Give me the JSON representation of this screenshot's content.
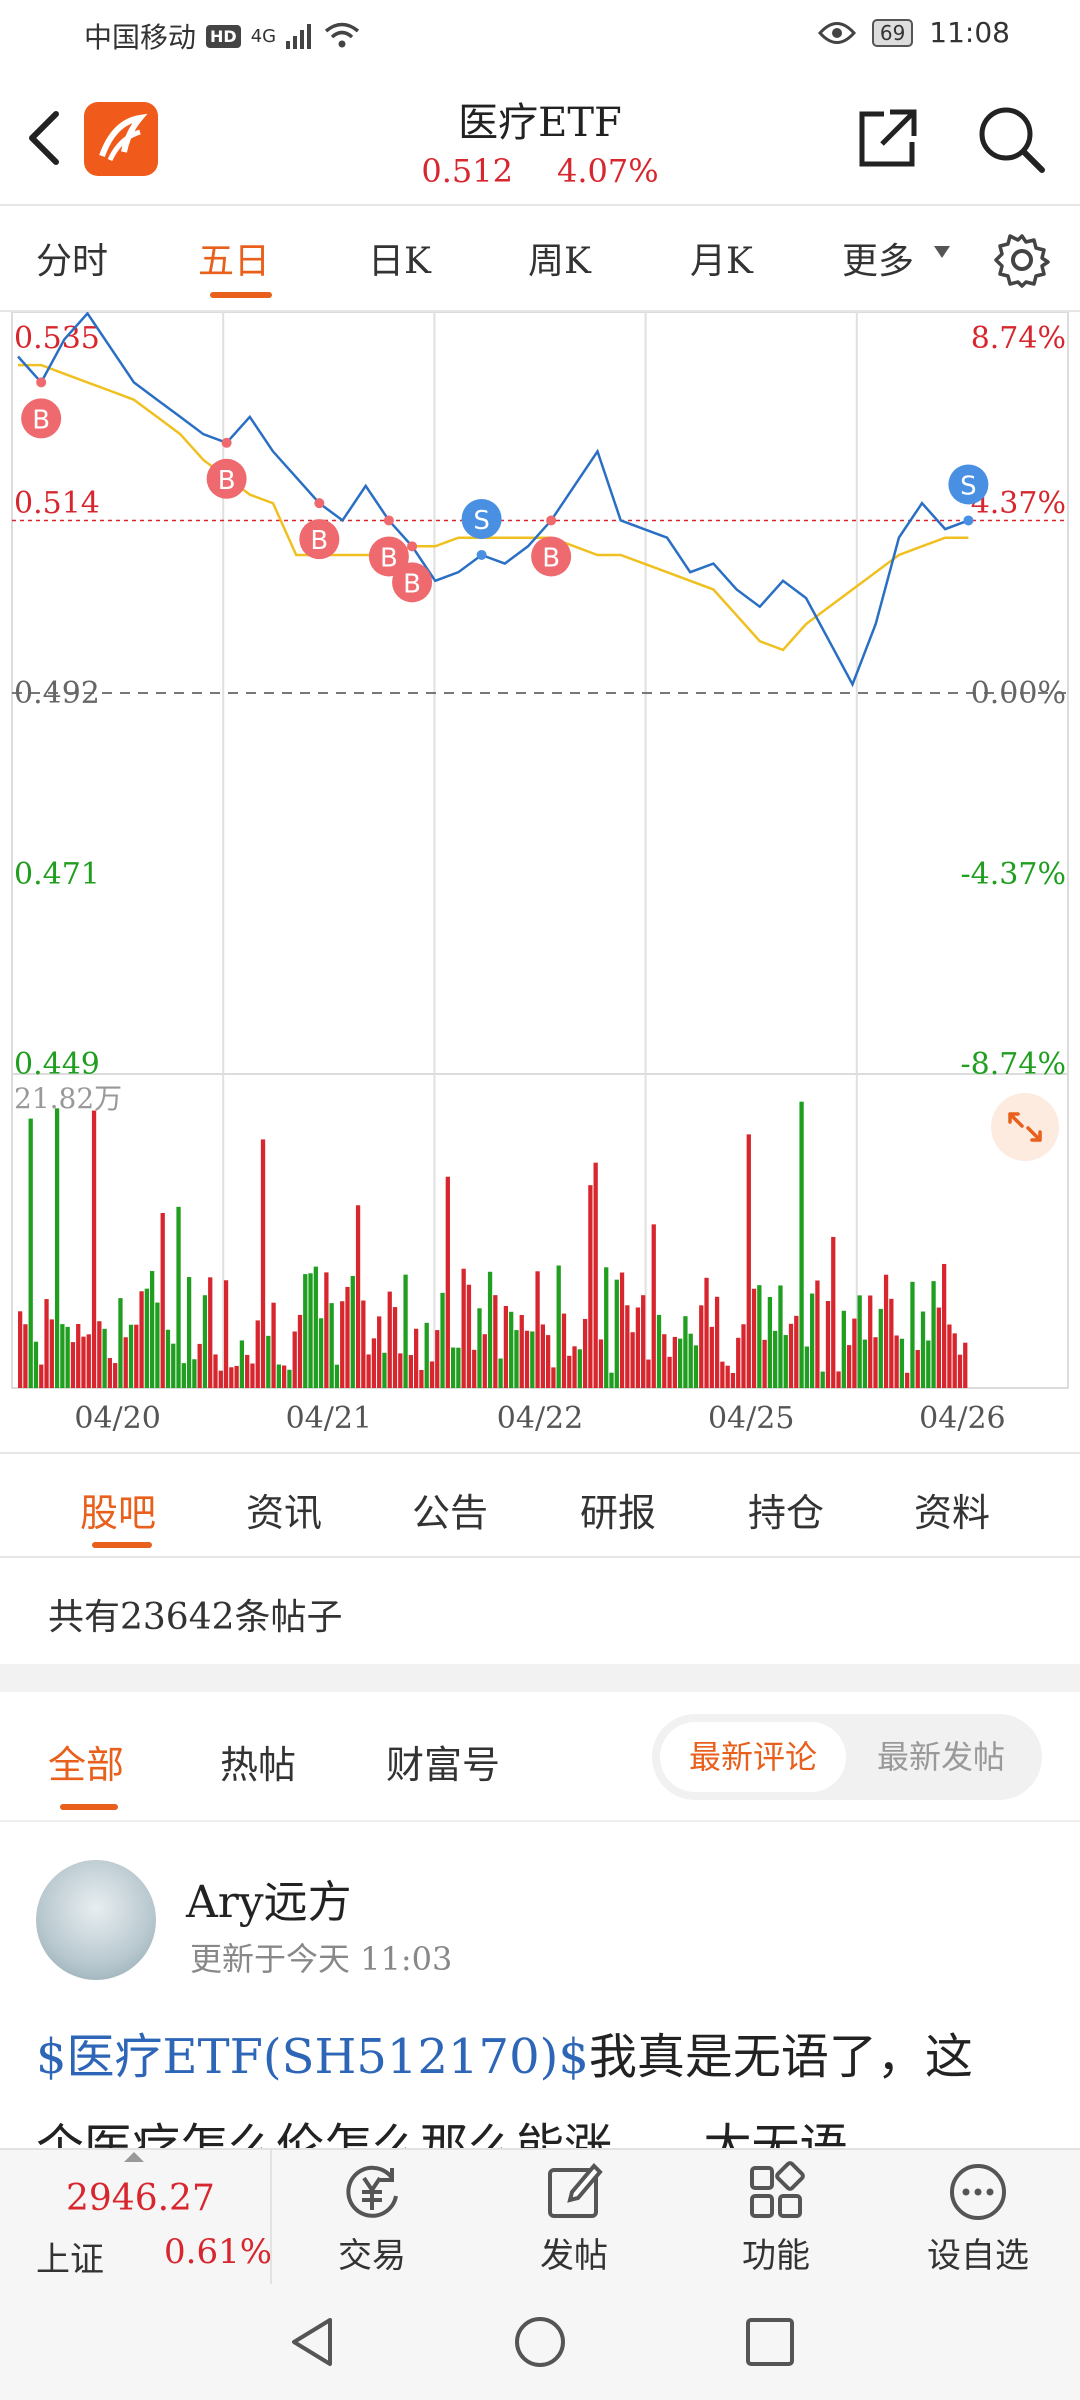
{
  "status": {
    "carrier": "中国移动",
    "hd": "HD",
    "network": "4G",
    "battery": "69",
    "time": "11:08"
  },
  "header": {
    "title": "医疗ETF",
    "price": "0.512",
    "change_pct": "4.07%"
  },
  "chart_tabs": [
    "分时",
    "五日",
    "日K",
    "周K",
    "月K",
    "更多"
  ],
  "chart_tabs_active": "五日",
  "chart_data": {
    "type": "line",
    "x_ticks": [
      "04/20",
      "04/21",
      "04/22",
      "04/25",
      "04/26"
    ],
    "y_left_labels": [
      "0.535",
      "0.514",
      "0.492",
      "0.471",
      "0.449"
    ],
    "y_right_labels": [
      "8.74%",
      "4.37%",
      "0.00%",
      "-4.37%",
      "-8.74%"
    ],
    "ylim": [
      0.449,
      0.535
    ],
    "prev_close": 0.492,
    "volume_max_label": "21.82万",
    "series": [
      {
        "values": [
          0.531,
          0.528,
          0.533,
          0.536,
          0.532,
          0.528,
          0.526,
          0.524,
          0.522,
          0.521,
          0.524,
          0.52,
          0.517,
          0.514,
          0.512,
          0.516,
          0.512,
          0.509,
          0.505,
          0.506,
          0.508,
          0.507,
          0.509,
          0.512,
          0.516,
          0.52,
          0.512,
          0.511,
          0.51,
          0.506,
          0.507,
          0.504,
          0.502,
          0.505,
          0.503,
          0.498,
          0.493,
          0.5,
          0.51,
          0.514,
          0.511,
          0.512
        ]
      },
      {
        "values": [
          0.53,
          0.53,
          0.529,
          0.528,
          0.527,
          0.526,
          0.524,
          0.522,
          0.519,
          0.517,
          0.515,
          0.514,
          0.508,
          0.508,
          0.508,
          0.508,
          0.508,
          0.509,
          0.509,
          0.51,
          0.51,
          0.51,
          0.51,
          0.51,
          0.509,
          0.508,
          0.508,
          0.507,
          0.506,
          0.505,
          0.504,
          0.501,
          0.498,
          0.497,
          0.5,
          0.502,
          0.504,
          0.506,
          0.508,
          0.509,
          0.51,
          0.51
        ]
      }
    ],
    "markers": [
      {
        "label": "B",
        "type": "buy",
        "x_index": 1
      },
      {
        "label": "B",
        "type": "buy",
        "x_index": 9
      },
      {
        "label": "B",
        "type": "buy",
        "x_index": 13
      },
      {
        "label": "B",
        "type": "buy",
        "x_index": 16
      },
      {
        "label": "B",
        "type": "buy",
        "x_index": 17
      },
      {
        "label": "S",
        "type": "sell",
        "x_index": 20
      },
      {
        "label": "B",
        "type": "buy",
        "x_index": 23
      },
      {
        "label": "S",
        "type": "sell",
        "x_index": 41
      }
    ]
  },
  "section_tabs": [
    "股吧",
    "资讯",
    "公告",
    "研报",
    "持仓",
    "资料"
  ],
  "post_count": "共有23642条帖子",
  "filter_tabs": [
    "全部",
    "热帖",
    "财富号"
  ],
  "sort_options": [
    "最新评论",
    "最新发帖"
  ],
  "post": {
    "username": "Ary远方",
    "time": "更新于今天 11:03",
    "link": "$医疗ETF(SH512170)$",
    "text_line1": "我真是无语了，这",
    "text_line2": "个医疗怎么伦怎么那么能涨......太无语"
  },
  "bottom": {
    "index_value": "2946.27",
    "index_name": "上证",
    "index_pct": "0.61%",
    "items": [
      "交易",
      "发帖",
      "功能",
      "设自选"
    ]
  },
  "colors": {
    "accent": "#e8601c",
    "up": "#d7262e",
    "down": "#1f9e1f",
    "price_line": "#2a6fc4",
    "avg_line": "#f0c020",
    "sell_marker": "#4a90e2",
    "buy_marker": "#ee6a6e"
  }
}
